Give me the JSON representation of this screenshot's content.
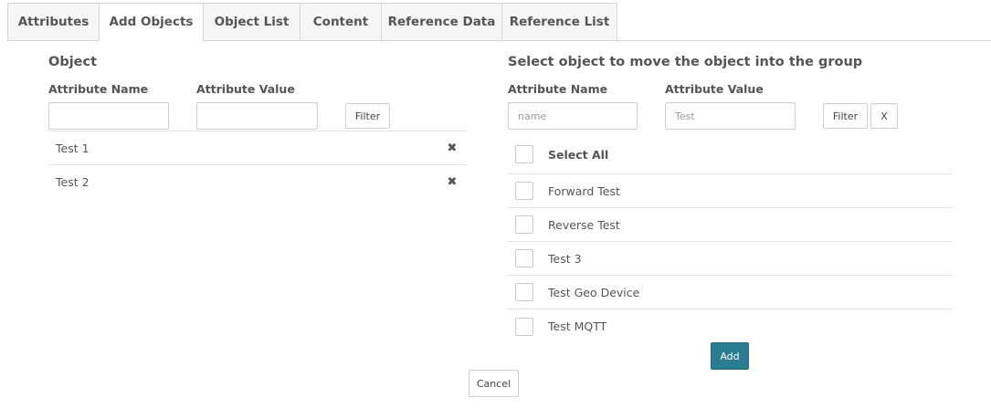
{
  "tabs": [
    {
      "label": "Attributes"
    },
    {
      "label": "Add Objects"
    },
    {
      "label": "Object List"
    },
    {
      "label": "Content"
    },
    {
      "label": "Reference Data"
    },
    {
      "label": "Reference List"
    }
  ],
  "active_tab": "Add Objects",
  "left": {
    "title": "Object",
    "attr_name_label": "Attribute Name",
    "attr_value_label": "Attribute Value",
    "attr_name_value": "",
    "attr_value_value": "",
    "filter_label": "Filter",
    "items": [
      {
        "label": "Test 1",
        "remove_icon": "✖"
      },
      {
        "label": "Test 2",
        "remove_icon": "✖"
      }
    ]
  },
  "right": {
    "title": "Select object to move the object into the group",
    "attr_name_label": "Attribute Name",
    "attr_value_label": "Attribute Value",
    "attr_name_placeholder": "name",
    "attr_value_placeholder": "Test",
    "filter_label": "Filter",
    "clear_label": "X",
    "select_all_label": "Select All",
    "items": [
      {
        "label": "Forward Test"
      },
      {
        "label": "Reverse Test"
      },
      {
        "label": "Test 3"
      },
      {
        "label": "Test Geo Device"
      },
      {
        "label": "Test MQTT"
      }
    ],
    "add_label": "Add"
  },
  "cancel_label": "Cancel",
  "colors": {
    "primary": "#2a7c90",
    "text": "#555555",
    "border": "#d6d6d6"
  }
}
